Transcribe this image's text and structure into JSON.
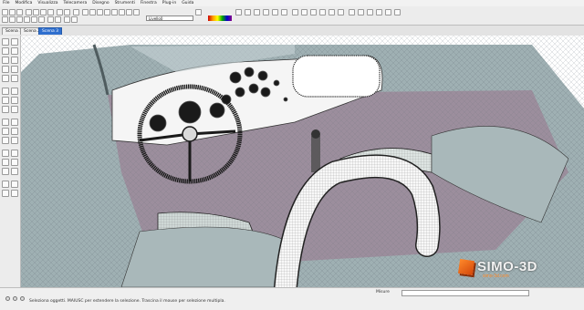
{
  "menu": [
    "File",
    "Modifica",
    "Visualizza",
    "Telecamera",
    "Disegno",
    "Strumenti",
    "Finestra",
    "Plug-in",
    "Guida"
  ],
  "toolbar": {
    "layer_value": "Livello0"
  },
  "scene_tabs": [
    {
      "label": "Scena 1",
      "active": false
    },
    {
      "label": "Scena 2",
      "active": false
    },
    {
      "label": "Scena 3",
      "active": true
    }
  ],
  "status": {
    "hint": "Seleziona oggetti. MAIUSC per estendere la selezione. Trascina il mouse per selezione multipla.",
    "measure_label": "Misure"
  },
  "logo": {
    "brand": "SIMO-3D",
    "sub": "simo-3d.com"
  },
  "colors": {
    "active_tab": "#2f6fce",
    "mesh_body": "#9fb0b3",
    "interior": "#9c8e9d",
    "logo_accent": "#ff8a2a"
  }
}
